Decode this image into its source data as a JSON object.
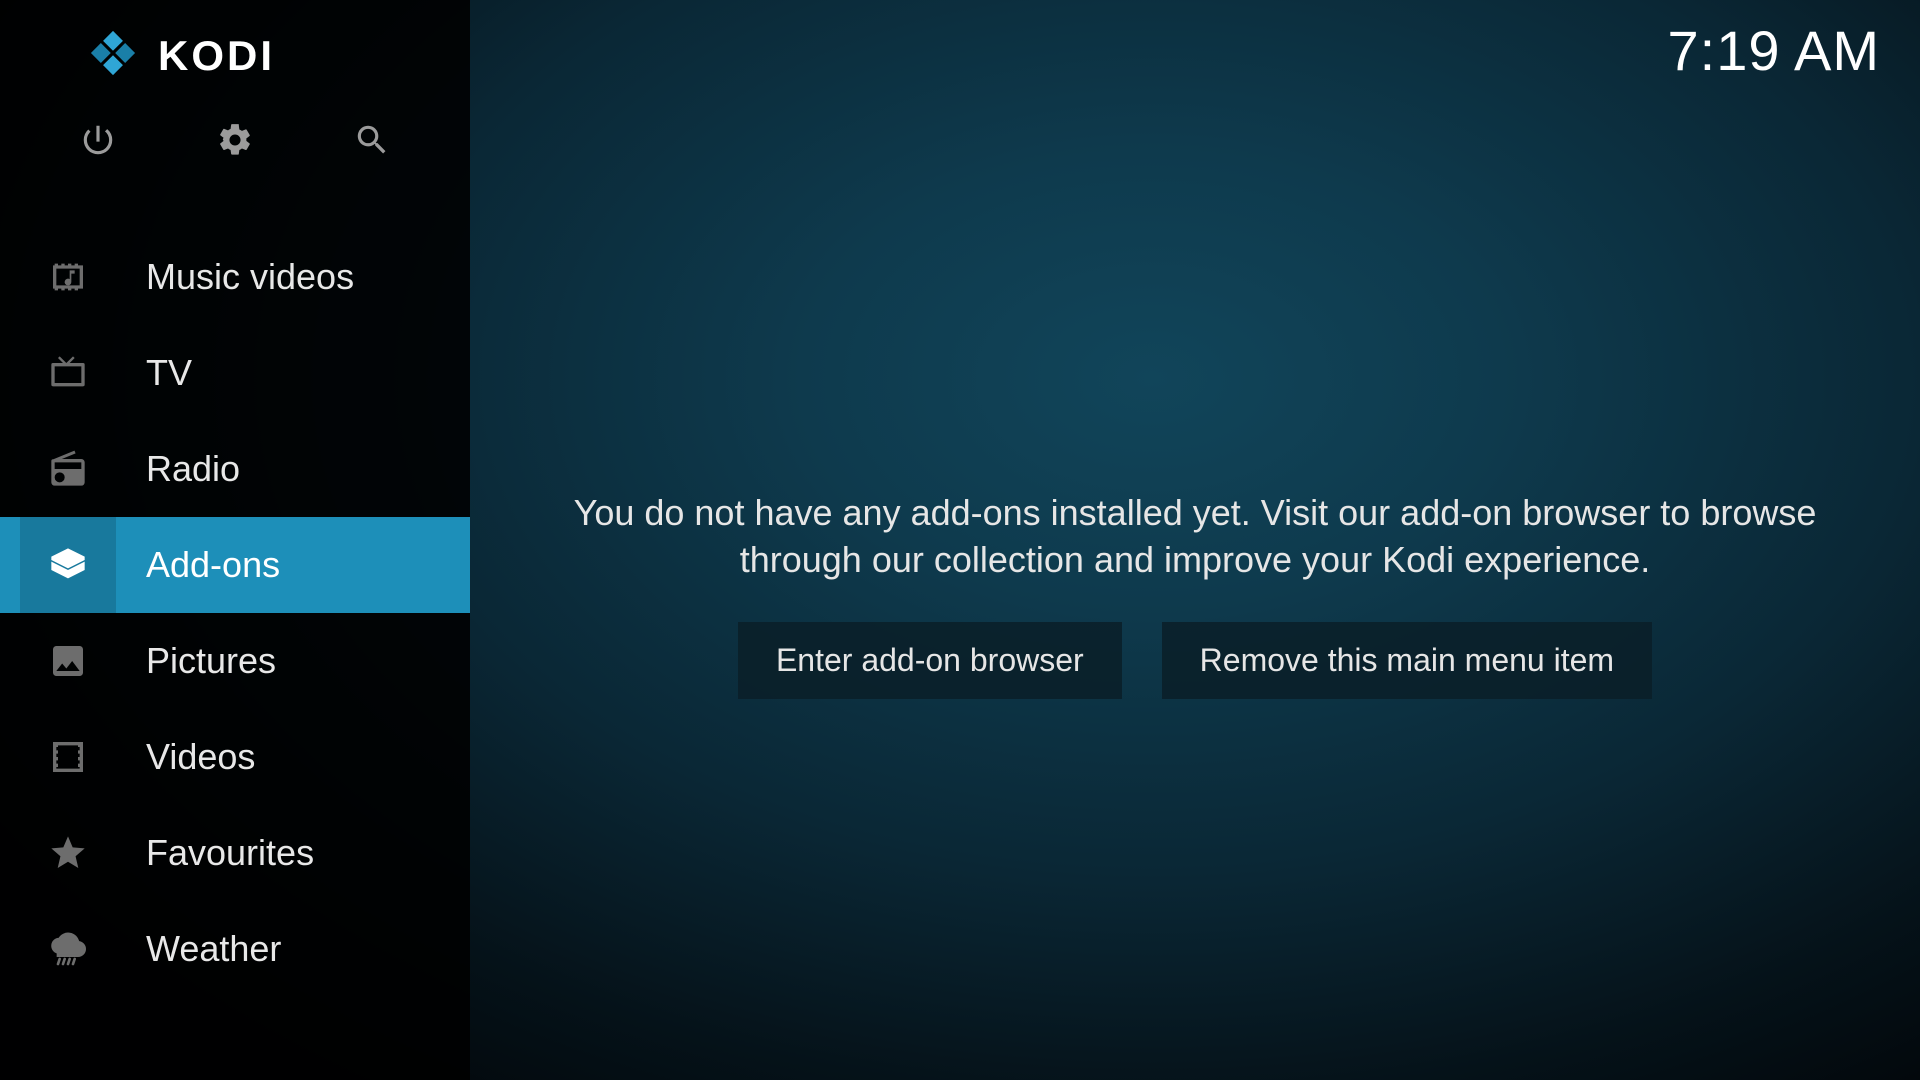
{
  "header": {
    "brand": "KODI",
    "clock": "7:19 AM"
  },
  "toolbar": {
    "power": "power-icon",
    "settings": "gear-icon",
    "search": "search-icon"
  },
  "sidebar": {
    "items": [
      {
        "id": "music-videos",
        "label": "Music videos",
        "icon": "music-video-icon",
        "active": false
      },
      {
        "id": "tv",
        "label": "TV",
        "icon": "tv-icon",
        "active": false
      },
      {
        "id": "radio",
        "label": "Radio",
        "icon": "radio-icon",
        "active": false
      },
      {
        "id": "addons",
        "label": "Add-ons",
        "icon": "addons-icon",
        "active": true
      },
      {
        "id": "pictures",
        "label": "Pictures",
        "icon": "pictures-icon",
        "active": false
      },
      {
        "id": "videos",
        "label": "Videos",
        "icon": "videos-icon",
        "active": false
      },
      {
        "id": "favourites",
        "label": "Favourites",
        "icon": "favourites-icon",
        "active": false
      },
      {
        "id": "weather",
        "label": "Weather",
        "icon": "weather-icon",
        "active": false
      }
    ]
  },
  "main": {
    "message": "You do not have any add-ons installed yet. Visit our add-on browser to browse through our collection and improve your Kodi experience.",
    "buttons": {
      "enter": "Enter add-on browser",
      "remove": "Remove this main menu item"
    }
  },
  "colors": {
    "accent": "#1d8fb9"
  }
}
